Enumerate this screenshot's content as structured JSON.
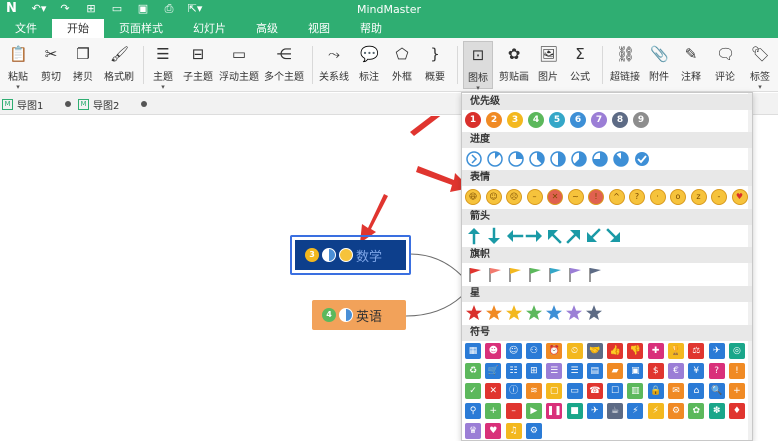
{
  "app": {
    "title": "MindMaster"
  },
  "menu": [
    "文件",
    "开始",
    "页面样式",
    "幻灯片",
    "高级",
    "视图",
    "帮助"
  ],
  "menu_active": 1,
  "ribbon": {
    "paste": "粘贴",
    "cut": "剪切",
    "copy": "拷贝",
    "format_brush": "格式刷",
    "topic": "主题",
    "subtopic": "子主题",
    "floating_topic": "浮动主题",
    "multi_topic": "多个主题",
    "relationship": "关系线",
    "callout": "标注",
    "boundary": "外框",
    "summary": "概要",
    "icon": "图标",
    "clipart": "剪贴画",
    "picture": "图片",
    "formula": "公式",
    "hyperlink": "超链接",
    "attachment": "附件",
    "note": "注释",
    "comment": "评论",
    "tag": "标签"
  },
  "tabs": [
    "导图1",
    "导图2"
  ],
  "topics": {
    "math": {
      "label": "数学",
      "priority": "3"
    },
    "english": {
      "label": "英语",
      "priority": "4"
    }
  },
  "panel": {
    "categories": {
      "priority": "优先级",
      "progress": "进度",
      "expression": "表情",
      "arrow": "箭头",
      "flag": "旗帜",
      "star": "星",
      "symbol": "符号"
    },
    "priority_numbers": [
      "1",
      "2",
      "3",
      "4",
      "5",
      "6",
      "7",
      "8",
      "9"
    ],
    "priority_colors": [
      "#d9302c",
      "#f08a24",
      "#f3b81f",
      "#5cb85c",
      "#35a7c8",
      "#3d8fd6",
      "#9b7ed6",
      "#5d6b85",
      "#8d8d8d"
    ]
  },
  "colors": {
    "brand": "#2fae72",
    "math_topic_bg": "#0d3f8c",
    "english_topic_bg": "#f2a25a",
    "arrow_red": "#e0352f"
  },
  "icons": {
    "logo": "mindmaster-logo",
    "undo": "undo-icon",
    "redo": "redo-icon",
    "new": "new-file-icon",
    "open": "open-folder-icon",
    "save": "save-icon",
    "print": "print-icon",
    "export": "export-icon"
  }
}
